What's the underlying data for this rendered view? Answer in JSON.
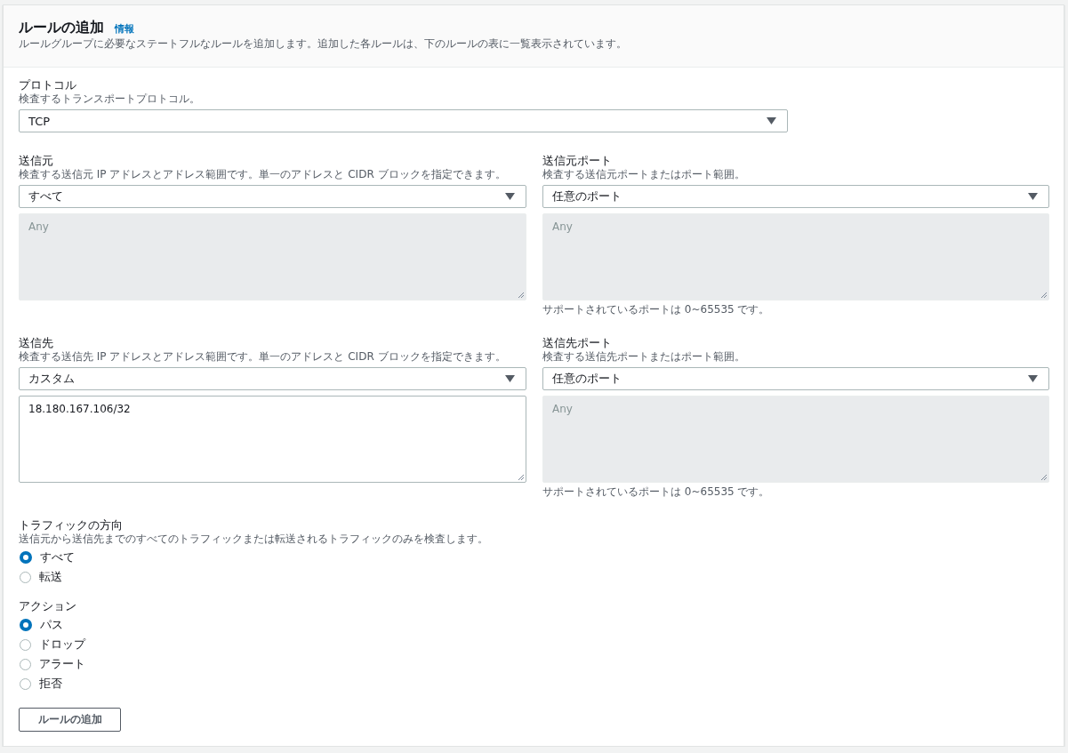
{
  "header": {
    "title": "ルールの追加",
    "info_link": "情報",
    "description": "ルールグループに必要なステートフルなルールを追加します。追加した各ルールは、下のルールの表に一覧表示されています。"
  },
  "protocol": {
    "label": "プロトコル",
    "description": "検査するトランスポートプロトコル。",
    "value": "TCP"
  },
  "endpoint_rows": [
    [
      {
        "label": "送信元",
        "description": "検査する送信元 IP アドレスとアドレス範囲です。単一のアドレスと CIDR ブロックを指定できます。",
        "value": "すべて",
        "area": {
          "placeholder": "Any",
          "disabled": true
        }
      },
      {
        "label": "送信元ポート",
        "description": "検査する送信元ポートまたはポート範囲。",
        "value": "任意のポート",
        "area": {
          "placeholder": "Any",
          "disabled": true
        },
        "hint": "サポートされているポートは 0~65535 です。"
      }
    ],
    [
      {
        "label": "送信先",
        "description": "検査する送信先 IP アドレスとアドレス範囲です。単一のアドレスと CIDR ブロックを指定できます。",
        "value": "カスタム",
        "area": {
          "value": "18.180.167.106/32",
          "disabled": false
        }
      },
      {
        "label": "送信先ポート",
        "description": "検査する送信先ポートまたはポート範囲。",
        "value": "任意のポート",
        "area": {
          "placeholder": "Any",
          "disabled": true
        },
        "hint": "サポートされているポートは 0~65535 です。"
      }
    ]
  ],
  "radio_groups": [
    {
      "label": "トラフィックの方向",
      "description": "送信元から送信先までのすべてのトラフィックまたは転送されるトラフィックのみを検査します。",
      "options": [
        {
          "label": "すべて",
          "selected": true
        },
        {
          "label": "転送",
          "selected": false
        }
      ]
    },
    {
      "label": "アクション",
      "options": [
        {
          "label": "パス",
          "selected": true
        },
        {
          "label": "ドロップ",
          "selected": false
        },
        {
          "label": "アラート",
          "selected": false
        },
        {
          "label": "拒否",
          "selected": false
        }
      ]
    }
  ],
  "submit_button": "ルールの追加"
}
